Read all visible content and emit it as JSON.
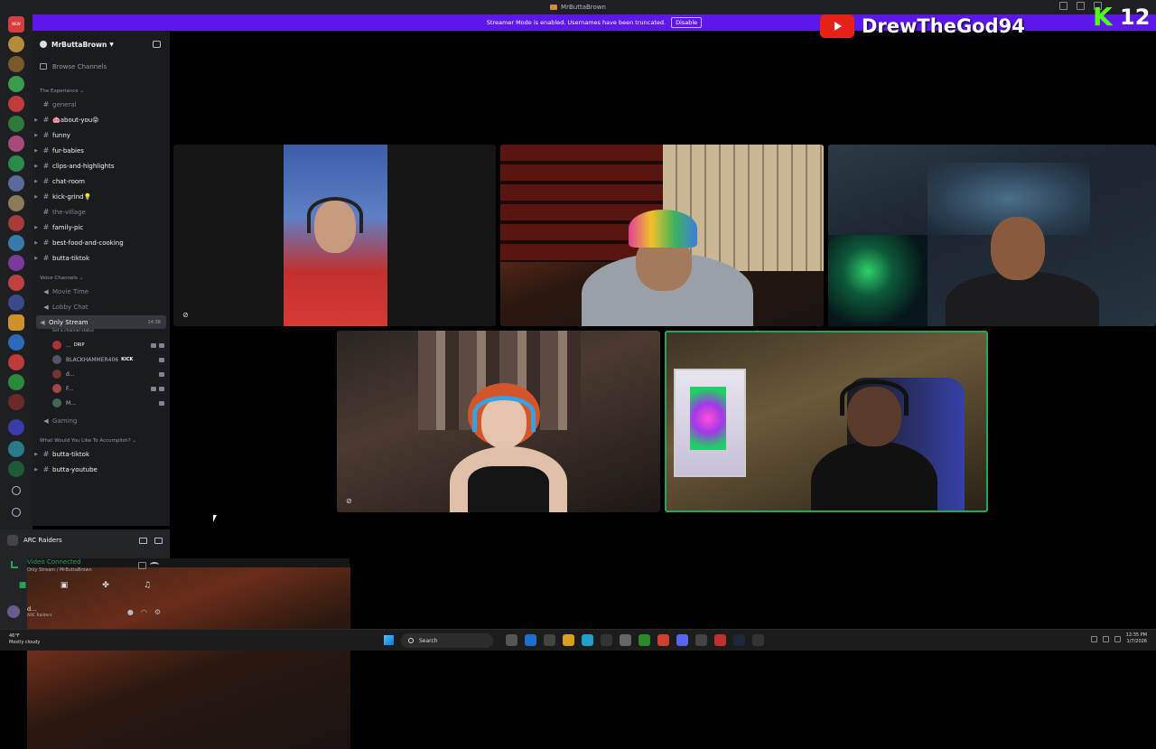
{
  "window": {
    "title": "MrButtaBrown"
  },
  "banner": {
    "text": "Streamer Mode is enabled. Usernames have been truncated.",
    "button": "Disable"
  },
  "overlay": {
    "youtube_name": "DrewTheGod94",
    "kick_count": "12"
  },
  "rail": {
    "new_label": "NEW"
  },
  "server": {
    "name": "MrButtaBrown",
    "browse": "Browse Channels"
  },
  "categories": {
    "experience": "The Experiance",
    "voice": "Voice Channels",
    "accomplish": "What Would You Like To Accomplish?"
  },
  "text_channels": [
    {
      "name": "general",
      "dim": true
    },
    {
      "name": "🐽about-you😝",
      "dim": false
    },
    {
      "name": "funny",
      "dim": false
    },
    {
      "name": "fur-babies",
      "dim": false
    },
    {
      "name": "clips-and-highlights",
      "dim": false
    },
    {
      "name": "chat-room",
      "dim": false
    },
    {
      "name": "kick-grind💡",
      "dim": false
    },
    {
      "name": "the-village",
      "dim": true
    },
    {
      "name": "family-pic",
      "dim": false
    },
    {
      "name": "best-food-and-cooking",
      "dim": false
    },
    {
      "name": "butta-tiktok",
      "dim": false
    }
  ],
  "voice_channels": [
    {
      "name": "Movie Time"
    },
    {
      "name": "Lobby Chat"
    },
    {
      "name": "Only Stream",
      "timer": "24:38",
      "status": "Set a channel status"
    },
    {
      "name": "Gaming"
    }
  ],
  "voice_users": [
    {
      "name": "... ",
      "tag": "DRIP"
    },
    {
      "name": "BLACKHAMMER406",
      "tag": "KICK"
    },
    {
      "name": "d...",
      "tag": ""
    },
    {
      "name": "F...",
      "tag": ""
    },
    {
      "name": "M...",
      "tag": ""
    }
  ],
  "bottom_channels": [
    {
      "name": "butta-tiktok"
    },
    {
      "name": "butta-youtube"
    }
  ],
  "panel": {
    "activity": "ARC Raiders",
    "voice_status": "Video Connected",
    "voice_channel": "Only Stream / MrButtaBrown",
    "user_name": "d...",
    "user_status": "ARC Raiders"
  },
  "taskbar": {
    "temp": "46°F",
    "weather": "Mostly cloudy",
    "search": "Search",
    "time": "12:35 PM",
    "date": "1/7/2026"
  },
  "colors": {
    "accent": "#5e17eb",
    "connected": "#23a55a",
    "youtube": "#e62117",
    "kick": "#53fc18"
  }
}
